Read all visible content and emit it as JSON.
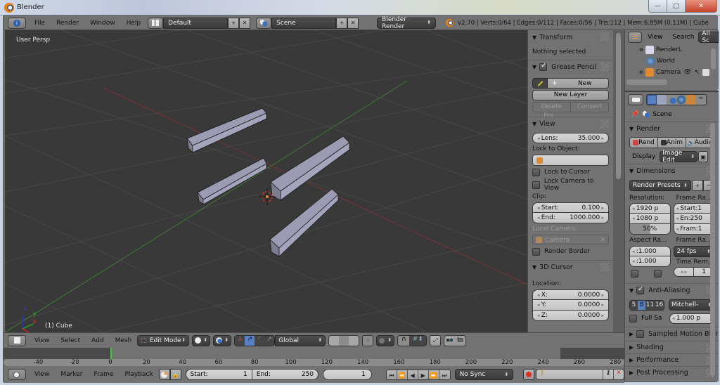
{
  "window": {
    "title": "Blender",
    "minimize": "—",
    "maximize": "□",
    "close": "✕"
  },
  "topbar": {
    "menus": [
      "File",
      "Render",
      "Window",
      "Help"
    ],
    "screen_layout": "Default",
    "scene": "Scene",
    "render_engine": "Blender Render",
    "stats": "v2.70 | Verts:0/64 | Edges:0/112 | Faces:0/56 | Tris:112 | Mem:6.85M (0.11M) | Cube"
  },
  "viewport": {
    "view_label": "User Persp",
    "object_label": "(1) Cube",
    "axes": {
      "x": "x",
      "y": "y",
      "z": "z"
    }
  },
  "npanel": {
    "transform": {
      "title": "Transform",
      "status": "Nothing selected"
    },
    "grease_pencil": {
      "title": "Grease Pencil",
      "enabled": true,
      "new_label": "New",
      "new_layer": "New Layer",
      "delete_frame": "Delete Fra...",
      "convert": "Convert"
    },
    "view": {
      "title": "View",
      "lens_label": "Lens:",
      "lens_value": "35.000",
      "lock_to_object": "Lock to Object:",
      "lock_to_cursor": "Lock to Cursor",
      "lock_camera_to_view": "Lock Camera to View",
      "clip_label": "Clip:",
      "clip_start_label": "Start:",
      "clip_start": "0.100",
      "clip_end_label": "End:",
      "clip_end": "1000.000",
      "local_camera": "Local Camera:",
      "camera": "Camera",
      "render_border": "Render Border"
    },
    "cursor": {
      "title": "3D Cursor",
      "location": "Location:",
      "x_label": "X:",
      "x": "0.0000",
      "y_label": "Y:",
      "y": "0.0000",
      "z_label": "Z:",
      "z": "0.0000"
    }
  },
  "outliner": {
    "menus": [
      "View",
      "Search"
    ],
    "filter": "All Sc",
    "items": [
      "RenderL",
      "World",
      "Camera"
    ]
  },
  "properties": {
    "context": "Scene",
    "render": {
      "title": "Render",
      "render_btn": "Rend",
      "anim_btn": "Anim",
      "audio_btn": "Audio",
      "display_label": "Display",
      "display_value": "Image Edit"
    },
    "dimensions": {
      "title": "Dimensions",
      "presets": "Render Presets",
      "resolution_label": "Resolution:",
      "res_x": "1920 p",
      "res_y": "1080 p",
      "res_pct": "50%",
      "frame_range_label": "Frame Ra...",
      "start": "Start:1",
      "end": "En:250",
      "step": "Fram:1",
      "aspect_label": "Aspect Ra...",
      "aspect_x": ":1.000",
      "aspect_y": ":1.000",
      "frame_rate_label": "Frame Ra...",
      "fps": "24 fps",
      "time_remap_label": "Time Rem...",
      "time_remap_new": "1"
    },
    "anti_aliasing": {
      "title": "Anti-Aliasing",
      "enabled": true,
      "samples": [
        "5",
        "8",
        "11",
        "16"
      ],
      "selected_sample": "8",
      "filter": "Mitchell-",
      "full_sample": "Full Sa",
      "filter_size": "1.000 p"
    },
    "collapsed": [
      "Sampled Motion Blur",
      "Shading",
      "Performance",
      "Post Processing"
    ]
  },
  "view3d_header": {
    "menus": [
      "View",
      "Select",
      "Add",
      "Mesh"
    ],
    "mode": "Edit Mode",
    "orientation": "Global"
  },
  "timeline": {
    "ticks": [
      "-40",
      "-20",
      "0",
      "20",
      "40",
      "60",
      "80",
      "100",
      "120",
      "140",
      "160",
      "180",
      "200",
      "220",
      "240",
      "260",
      "280"
    ],
    "current_frame": 1,
    "menus": [
      "View",
      "Marker",
      "Frame",
      "Playback"
    ],
    "start_label": "Start:",
    "start": "1",
    "end_label": "End:",
    "end": "250",
    "frame": "1",
    "sync": "No Sync"
  }
}
